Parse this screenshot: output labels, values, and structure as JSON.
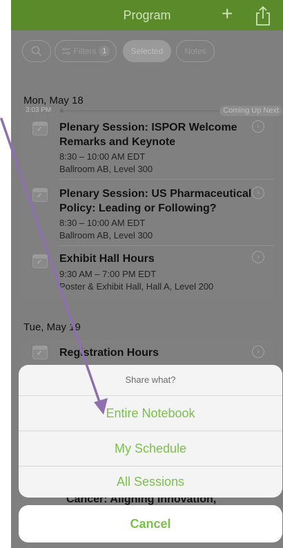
{
  "navbar": {
    "title": "Program",
    "plus": "+"
  },
  "toolbar": {
    "filters_label": "Filters",
    "filters_count": "1",
    "selected_label": "Selected",
    "notes_label": "Notes"
  },
  "day1": {
    "header": "Mon, May 18",
    "now_time": "3:03 PM",
    "coming_up": "Coming Up Next",
    "sessions": [
      {
        "title": "Plenary Session: ISPOR Welcome Remarks and Keynote",
        "time": "8:30 – 10:00 AM EDT",
        "location": "Ballroom AB, Level 300"
      },
      {
        "title": "Plenary Session: US Pharmaceutical Policy: Leading or Following?",
        "time": "8:30 – 10:00 AM EDT",
        "location": "Ballroom AB, Level 300"
      },
      {
        "title": "Exhibit Hall Hours",
        "time": "9:30 AM – 7:00 PM EDT",
        "location": "Poster & Exhibit Hall, Hall A, Level 200"
      }
    ]
  },
  "day2": {
    "header": "Tue, May 19",
    "sessions": [
      {
        "title": "Registration Hours"
      }
    ],
    "partial_text": "Cancer: Aligning Innovation,"
  },
  "share_sheet": {
    "header": "Share what?",
    "options": [
      "Entire Notebook",
      "My Schedule",
      "All Sessions"
    ],
    "cancel": "Cancel"
  },
  "colors": {
    "nav_green": "#5a8a2a",
    "accent_green": "#7bc04b",
    "annotation_arrow": "#8e6fb0"
  }
}
